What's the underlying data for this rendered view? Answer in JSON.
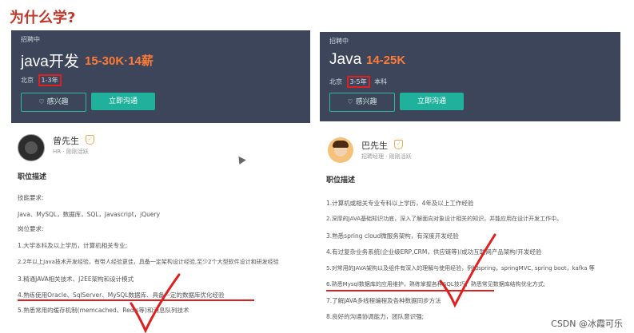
{
  "slide": {
    "title": "为什么学?"
  },
  "watermark": "CSDN @冰霞可乐",
  "colors": {
    "header_bg": "#3c4559",
    "salary": "#ff7b39",
    "chat_button": "#1fb19b",
    "annotation": "#e02020",
    "title": "#c0392b"
  },
  "jobs": [
    {
      "status": "招聘中",
      "title": "java开发",
      "salary": "15-30K·14薪",
      "city": "北京",
      "experience": "1-3年",
      "education": "",
      "interest_button": "感兴趣",
      "interest_icon": "heart-icon",
      "chat_button": "立即沟通",
      "recruiter_name": "曾先生",
      "recruiter_role": "HR · 刚刚活跃",
      "section_heading": "职位描述",
      "description": [
        "技能要求:",
        "Java、MySQL，数据库，SQL，Javascript，jQuery",
        "岗位要求:",
        "1.大学本科及以上学历，计算机相关专业;",
        "2.2年以上Java技术开发经验，有带人经验更佳，具备一定架构设计经验,至少2个大型软件设计和研发经验",
        "3.精通JAVA相关技术、J2EE架构和设计模式",
        "4.熟练使用Oracle、SqlServer、MySQL数据库、具备一定的数据库优化经验",
        "5.熟悉常用的缓存机制(memcached、Redis等)和消息队列技术"
      ],
      "highlighted_line_index": 6
    },
    {
      "status": "招聘中",
      "title": "Java",
      "salary": "14-25K",
      "city": "北京",
      "experience": "3-5年",
      "education": "本科",
      "interest_button": "感兴趣",
      "interest_icon": "heart-icon",
      "chat_button": "立即沟通",
      "recruiter_name": "巴先生",
      "recruiter_role": "招聘经理 · 刚刚活跃",
      "section_heading": "职位描述",
      "description": [
        "1.计算机或相关专业专科以上学历，4年及以上工作经验",
        "2.深厚的JAVA基础知识功底，深入了解面向对象设计相关的知识，并能应用在设计开发工作中。",
        "3.熟悉spring cloud微服务架构，有深度开发经验",
        "4.有过复杂业务系统(企业级ERP,CRM，供应链等)/成功互联网产品架构/开发经验",
        "5.对常用的JAVA架构以及组件有深入的理解与使用经验，例如spring，springMVC, spring boot，kafka 等",
        "6.熟悉Mysql数据库的应用维护，熟练掌握各种SQL技巧，熟悉常见数据库结构优化方式;",
        "7.了解JAVA多线程编程及各种数据同步方法",
        "8.良好的沟通协调能力，团队意识强;"
      ],
      "highlighted_line_index": 5
    }
  ]
}
